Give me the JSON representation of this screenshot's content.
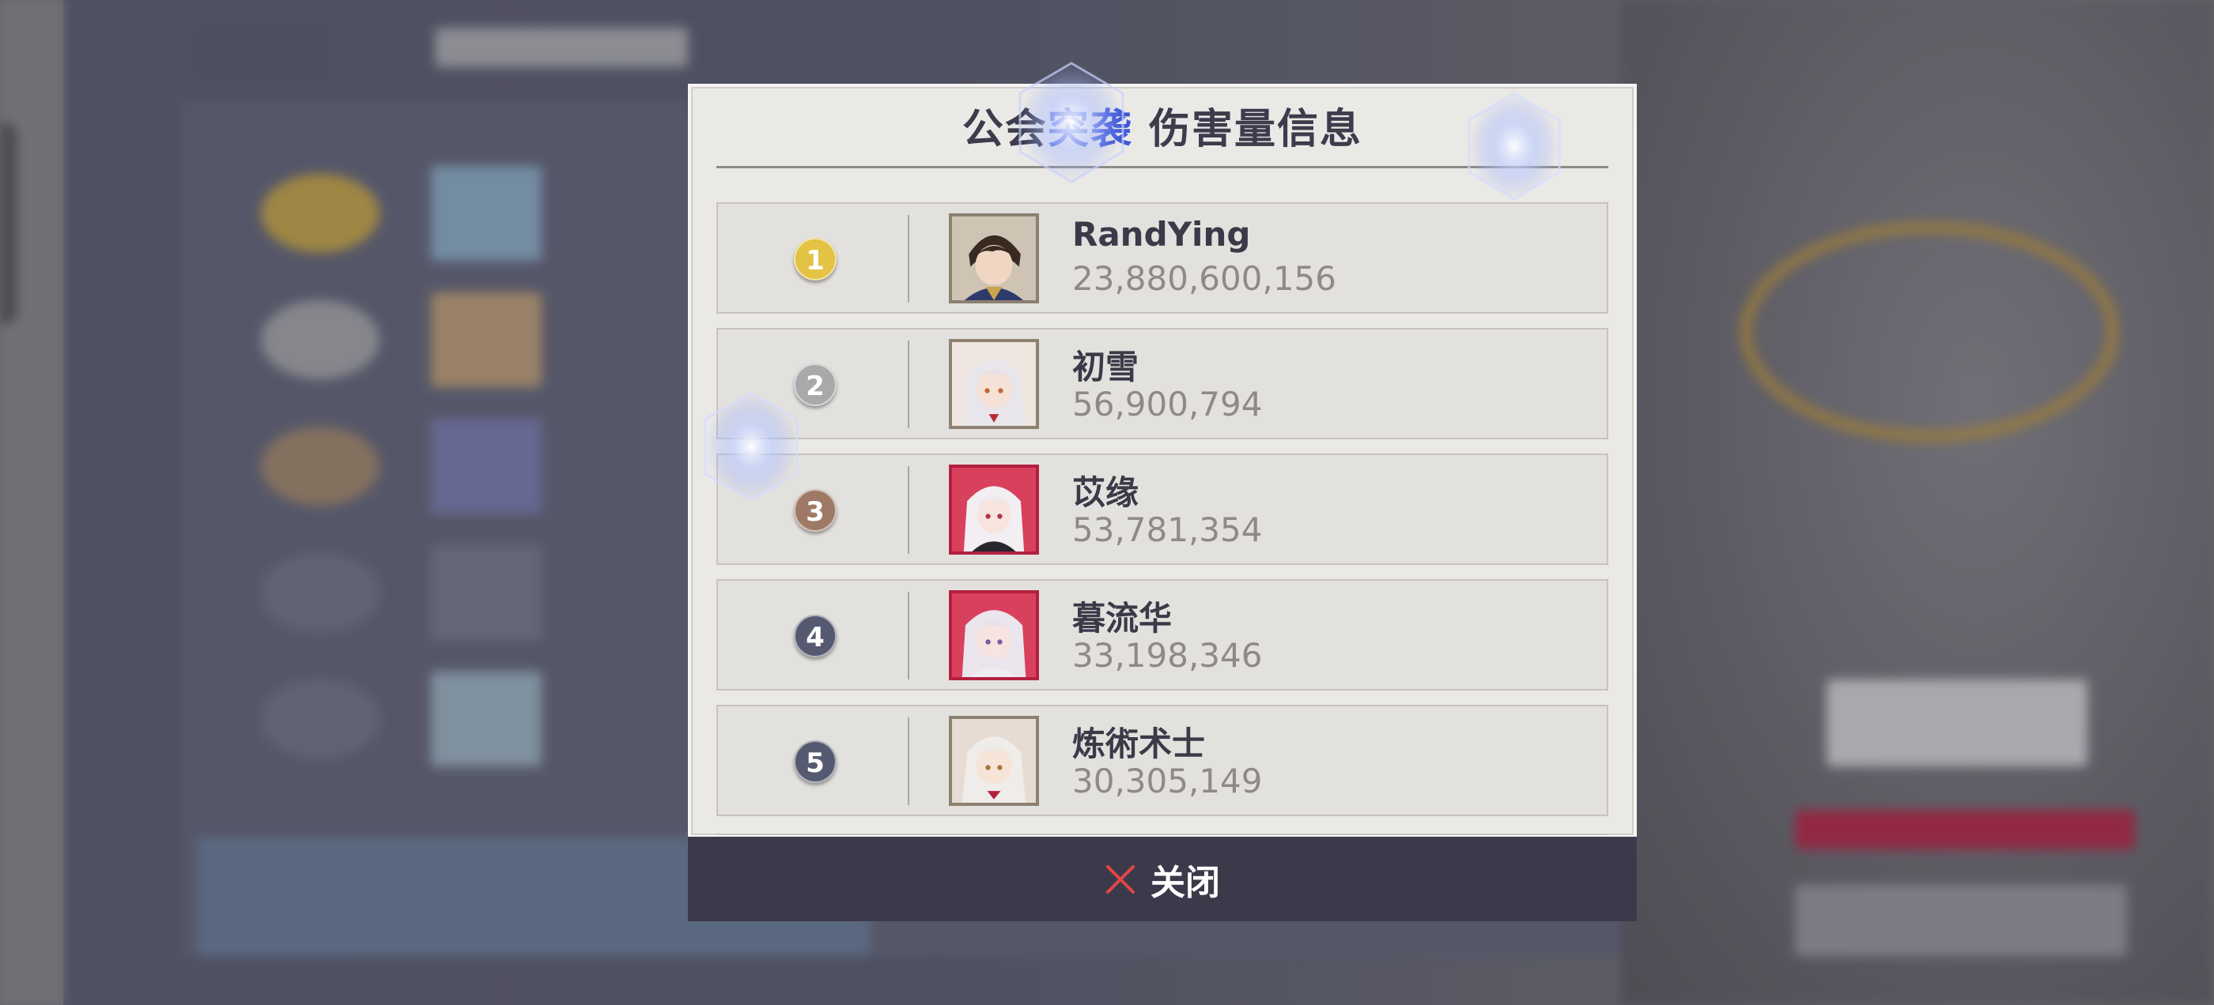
{
  "modal": {
    "title_prefix": "公会",
    "title_accent": "突袭",
    "title_suffix": " 伤害量信息",
    "close_label": "关闭",
    "close_icon": "close-x-icon",
    "close_color": "#e14646"
  },
  "ranking": [
    {
      "rank": "1",
      "name": "RandYing",
      "damage": "23,880,600,156",
      "badge_color": "#e3c343",
      "avatar_frame": "gold"
    },
    {
      "rank": "2",
      "name": "初雪",
      "damage": "56,900,794",
      "badge_color": "#a9a9ab",
      "avatar_frame": "gold"
    },
    {
      "rank": "3",
      "name": "苡缘",
      "damage": "53,781,354",
      "badge_color": "#9e7a66",
      "avatar_frame": "pink"
    },
    {
      "rank": "4",
      "name": "暮流华",
      "damage": "33,198,346",
      "badge_color": "#565a70",
      "avatar_frame": "pink"
    },
    {
      "rank": "5",
      "name": "炼術术士",
      "damage": "30,305,149",
      "badge_color": "#565a70",
      "avatar_frame": "gold"
    }
  ]
}
